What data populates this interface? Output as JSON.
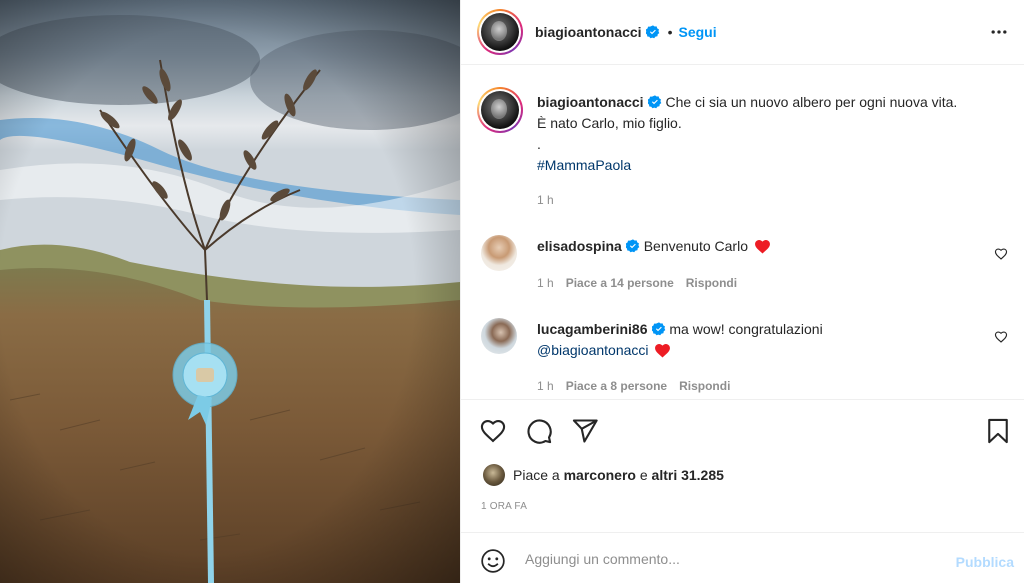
{
  "post": {
    "author": "biagioantonacci",
    "follow_label": "Segui",
    "separator": "•",
    "caption_line1": "Che ci sia un nuovo albero per ogni nuova vita.",
    "caption_line2": "È nato Carlo, mio figlio.",
    "caption_dot": ".",
    "hashtag": "#MammaPaola",
    "caption_time": "1 h"
  },
  "comments": [
    {
      "user": "elisadospina",
      "text": "Benvenuto Carlo",
      "time": "1 h",
      "likes": "Piace a 14 persone",
      "reply": "Rispondi"
    },
    {
      "user": "lucagamberini86",
      "text": "ma wow! congratulazioni",
      "mention": "@biagioantonacci",
      "time": "1 h",
      "likes": "Piace a 8 persone",
      "reply": "Rispondi"
    }
  ],
  "likes_bar": {
    "prefix": "Piace a",
    "user": "marconero",
    "conj": "e",
    "others": "altri 31.285",
    "time_ago": "1 ORA FA"
  },
  "add_comment": {
    "placeholder": "Aggiungi un commento...",
    "publish_label": "Pubblica"
  },
  "icons": [
    "verified-badge-icon",
    "more-options-icon",
    "heart-icon",
    "comment-icon",
    "share-icon",
    "bookmark-icon",
    "emoji-icon",
    "red-heart-icon"
  ],
  "colors": {
    "link_blue": "#0095f6",
    "hashtag": "#00376b",
    "muted": "#8e8e8e",
    "publish_disabled": "#b3dbff",
    "heart_red": "#ed4956"
  }
}
